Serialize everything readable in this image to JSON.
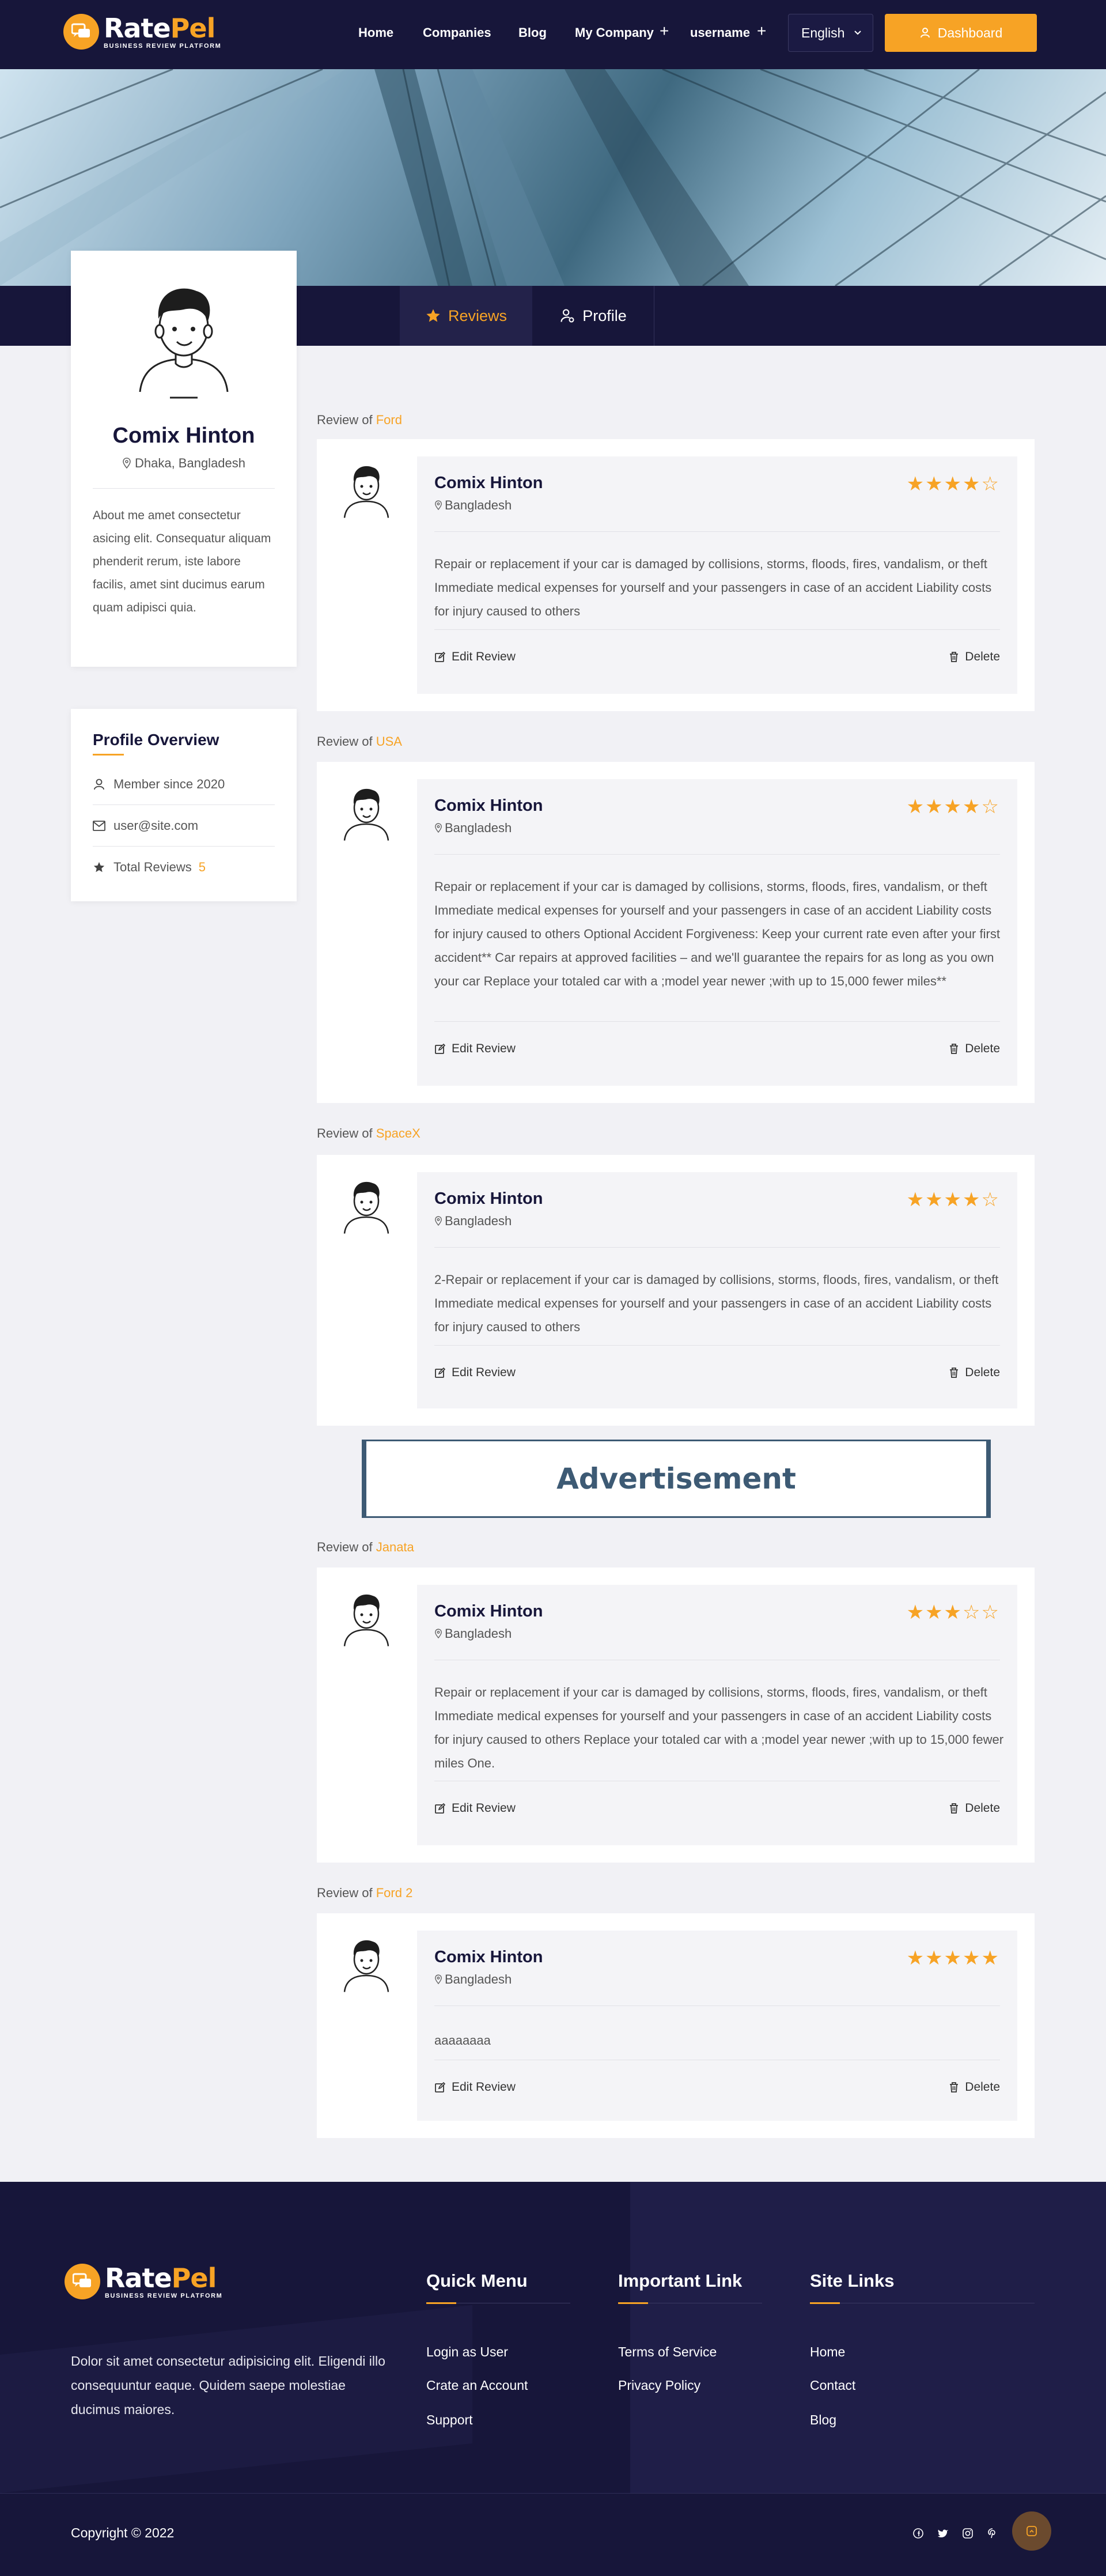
{
  "brand": {
    "name_white": "Rate",
    "name_orange": "Pel",
    "tagline": "BUSINESS REVIEW PLATFORM"
  },
  "nav": {
    "links": [
      "Home",
      "Companies",
      "Blog",
      "My Company",
      "username"
    ],
    "language": "English",
    "dashboard_label": "Dashboard"
  },
  "tabs": {
    "reviews": "Reviews",
    "profile": "Profile"
  },
  "profile": {
    "name": "Comix Hinton",
    "location": "Dhaka, Bangladesh",
    "about": "About me amet consectetur asicing elit. Consequatur aliquam phenderit rerum, iste labore facilis, amet sint ducimus earum quam adipisci quia."
  },
  "overview": {
    "title": "Profile Overview",
    "member_since": "Member since 2020",
    "email": "user@site.com",
    "total_reviews_label": "Total Reviews",
    "total_reviews": "5"
  },
  "review_of_prefix": "Review of",
  "edit_label": "Edit Review",
  "delete_label": "Delete",
  "reviews": [
    {
      "company": "Ford",
      "name": "Comix Hinton",
      "location": "Bangladesh",
      "rating": 4,
      "text": "Repair or replacement if your car is damaged by collisions, storms, floods, fires, vandalism, or theft Immediate medical expenses for yourself and your passengers in case of an accident Liability costs for injury caused to others"
    },
    {
      "company": "USA",
      "name": "Comix Hinton",
      "location": "Bangladesh",
      "rating": 4,
      "text": "Repair or replacement if your car is damaged by collisions, storms, floods, fires, vandalism, or theft Immediate medical expenses for yourself and your passengers in case of an accident Liability costs for injury caused to others Optional Accident Forgiveness: Keep your current rate even after your first accident** Car repairs at approved facilities – and we'll guarantee the repairs for as long as you own your car Replace your totaled car with a ;model year newer ;with up to 15,000 fewer miles**"
    },
    {
      "company": "SpaceX",
      "name": "Comix Hinton",
      "location": "Bangladesh",
      "rating": 4,
      "text": "2-Repair or replacement if your car is damaged by collisions, storms, floods, fires, vandalism, or theft Immediate medical expenses for yourself and your passengers in case of an accident Liability costs for injury caused to others"
    },
    {
      "company": "Janata",
      "name": "Comix Hinton",
      "location": "Bangladesh",
      "rating": 3,
      "text": "Repair or replacement if your car is damaged by collisions, storms, floods, fires, vandalism, or theft Immediate medical expenses for yourself and your passengers in case of an accident Liability costs for injury caused to others Replace your totaled car with a ;model year newer ;with up to 15,000 fewer miles One."
    },
    {
      "company": "Ford 2",
      "name": "Comix Hinton",
      "location": "Bangladesh",
      "rating": 5,
      "text": "aaaaaaaa"
    }
  ],
  "advertisement": "Advertisement",
  "footer": {
    "about": "Dolor sit amet consectetur adipisicing elit. Eligendi illo consequuntur eaque. Quidem saepe molestiae ducimus maiores.",
    "quick_menu": {
      "title": "Quick Menu",
      "links": [
        "Login as User",
        "Crate an Account",
        "Support"
      ]
    },
    "important": {
      "title": "Important Link",
      "links": [
        "Terms of Service",
        "Privacy Policy"
      ]
    },
    "site": {
      "title": "Site Links",
      "links": [
        "Home",
        "Contact",
        "Blog"
      ]
    },
    "copyright": "Copyright © 2022",
    "social_icons": [
      "facebook-icon",
      "twitter-icon",
      "instagram-icon",
      "pinterest-icon"
    ]
  },
  "colors": {
    "navy": "#17163a",
    "accent": "#f7a325"
  }
}
